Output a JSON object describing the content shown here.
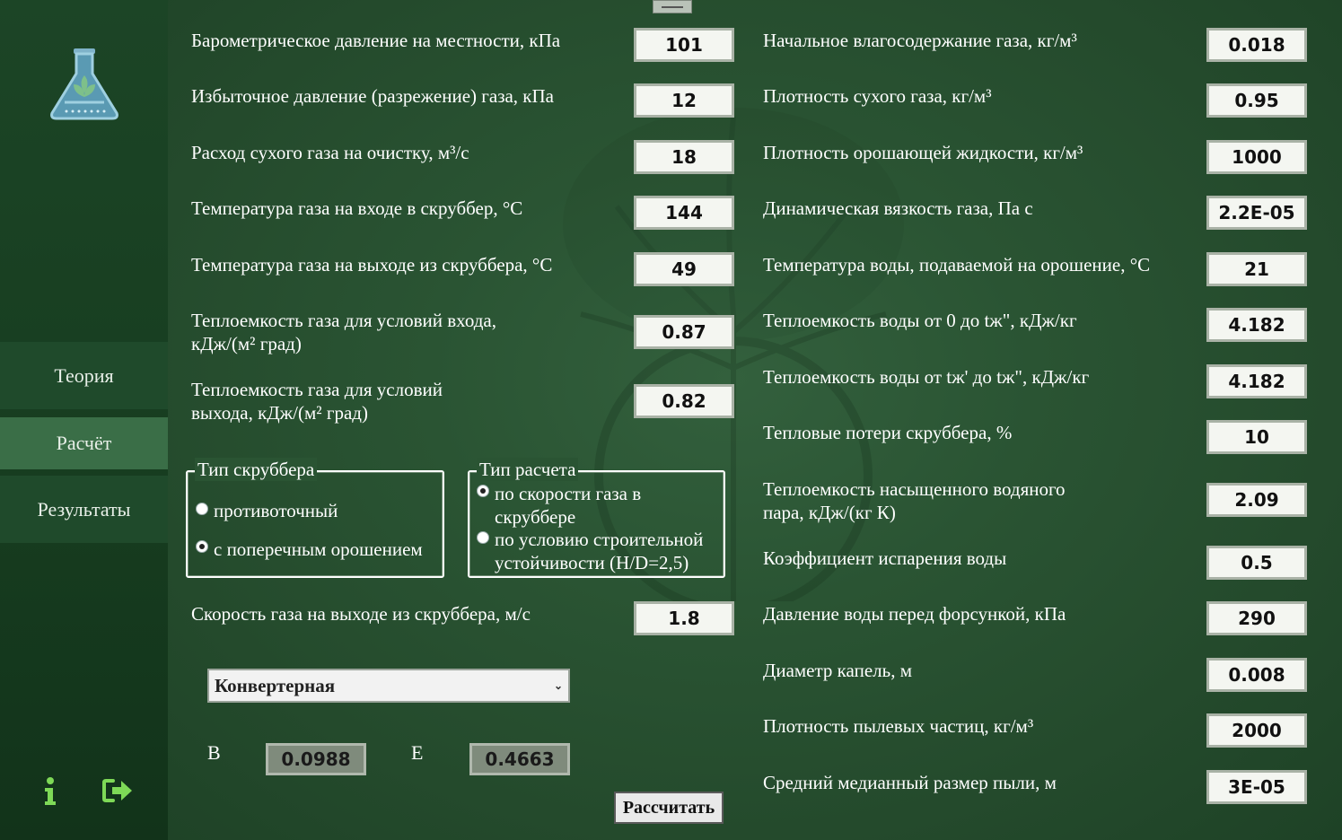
{
  "nav": {
    "items": [
      "Теория",
      "Расчёт",
      "Результаты"
    ],
    "active": "Расчёт"
  },
  "icons": {
    "logo": "flask-leaf-icon",
    "info": "info-icon",
    "exit": "sign-out-icon"
  },
  "left_fields": [
    {
      "label": "Барометрическое давление на местности, кПа",
      "value": "101"
    },
    {
      "label": "Избыточное давление (разрежение) газа, кПа",
      "value": "12"
    },
    {
      "label": "Расход сухого газа на очистку, м³/с",
      "value": "18"
    },
    {
      "label": "Температура газа на входе в скруббер, °С",
      "value": "144"
    },
    {
      "label": "Температура газа на выходе из скруббера, °С",
      "value": "49"
    },
    {
      "label": "Теплоемкость газа для условий входа,",
      "label2": "кДж/(м² град)",
      "value": "0.87"
    },
    {
      "label": "Теплоемкость газа для условий",
      "label2": "выхода, кДж/(м² град)",
      "value": "0.82"
    }
  ],
  "scrubber_type": {
    "title": "Тип скруббера",
    "options": [
      "противоточный",
      "с поперечным орошением"
    ],
    "selected": 1
  },
  "calc_type": {
    "title": "Тип расчета",
    "options": [
      {
        "line1": "по скорости газа в",
        "line2": "скруббере"
      },
      {
        "line1": "по условию строительной",
        "line2": "устойчивости (H/D=2,5)"
      }
    ],
    "selected": 0
  },
  "outlet_speed": {
    "label": "Скорость газа на выходе из скруббера, м/с",
    "value": "1.8"
  },
  "select": {
    "value": "Конвертерная"
  },
  "coeffs": {
    "b_label": "B",
    "b_value": "0.0988",
    "e_label": "E",
    "e_value": "0.4663"
  },
  "calculate_label": "Рассчитать",
  "right_fields": [
    {
      "label": "Начальное влагосодержание газа, кг/м³",
      "value": "0.018"
    },
    {
      "label": "Плотность сухого газа, кг/м³",
      "value": "0.95"
    },
    {
      "label": "Плотность орошающей жидкости, кг/м³",
      "value": "1000"
    },
    {
      "label": "Динамическая вязкость газа, Па с",
      "value": "2.2E-05"
    },
    {
      "label": "Температура воды, подаваемой на орошение, °С",
      "value": "21"
    },
    {
      "label": "Теплоемкость воды от 0 до tж\", кДж/кг",
      "value": "4.182"
    },
    {
      "label": "Теплоемкость воды от tж' до tж\", кДж/кг",
      "value": "4.182"
    },
    {
      "label": "Тепловые потери скруббера, %",
      "value": "10"
    },
    {
      "label": "Теплоемкость насыщенного водяного",
      "label2": "пара, кДж/(кг К)",
      "value": "2.09"
    },
    {
      "label": "Коэффициент испарения воды",
      "value": "0.5"
    },
    {
      "label": "Давление воды перед форсункой, кПа",
      "value": "290"
    },
    {
      "label": "Диаметр капель, м",
      "value": "0.008"
    },
    {
      "label": "Плотность пылевых частиц, кг/м³",
      "value": "2000"
    },
    {
      "label": "Средний медианный размер пыли, м",
      "value": "3E-05"
    }
  ]
}
